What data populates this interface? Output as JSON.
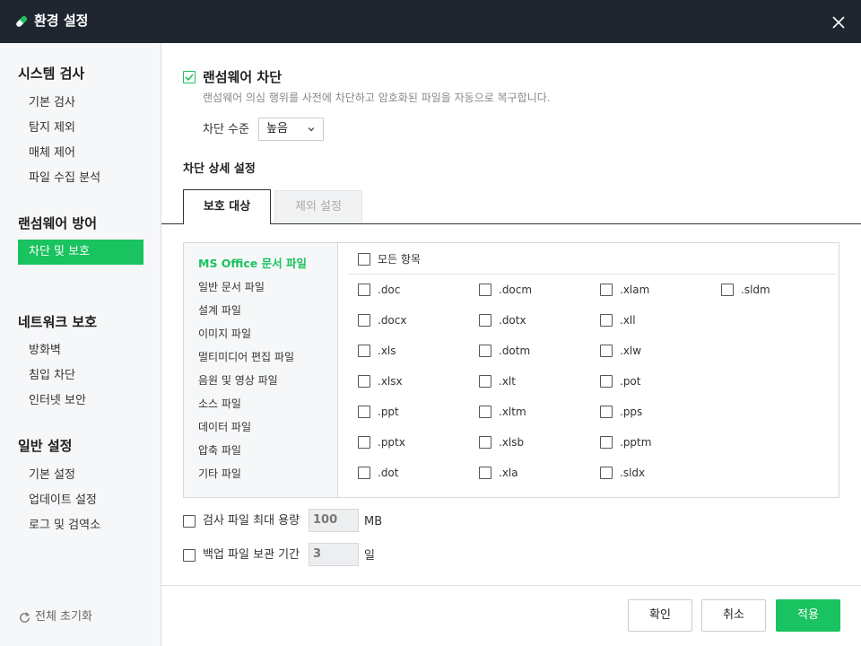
{
  "window": {
    "title": "환경 설정",
    "close_icon": "close-icon"
  },
  "sidebar": {
    "groups": [
      {
        "title": "시스템 검사",
        "items": [
          "기본 검사",
          "탐지 제외",
          "매체 제어",
          "파일 수집 분석"
        ]
      },
      {
        "title": "랜섬웨어 방어",
        "items": [
          "차단 및 보호"
        ]
      },
      {
        "title": "네트워크 보호",
        "items": [
          "방화벽",
          "침입 차단",
          "인터넷 보안"
        ]
      },
      {
        "title": "일반 설정",
        "items": [
          "기본 설정",
          "업데이트 설정",
          "로그 및 검역소"
        ]
      }
    ],
    "active_item": "차단 및 보호",
    "reset_label": "전체 초기화"
  },
  "ransomware": {
    "checked": true,
    "label": "랜섬웨어 차단",
    "description": "랜섬웨어 의심 행위를 사전에 차단하고 암호화된 파일을 자동으로 복구합니다.",
    "level_label": "차단 수준",
    "level_value": "높음"
  },
  "detail": {
    "title": "차단 상세 설정",
    "tabs": [
      {
        "label": "보호 대상",
        "active": true
      },
      {
        "label": "제외 설정",
        "active": false
      }
    ],
    "categories": [
      "MS Office 문서 파일",
      "일반 문서 파일",
      "설계 파일",
      "이미지 파일",
      "멀티미디어 편집 파일",
      "음원 및 영상 파일",
      "소스 파일",
      "데이터 파일",
      "압축 파일",
      "기타 파일"
    ],
    "active_category": "MS Office 문서 파일",
    "all_items_label": "모든 항목",
    "extensions": [
      [
        ".doc",
        ".docm",
        ".xlam",
        ".sldm"
      ],
      [
        ".docx",
        ".dotx",
        ".xll"
      ],
      [
        ".xls",
        ".dotm",
        ".xlw"
      ],
      [
        ".xlsx",
        ".xlt",
        ".pot"
      ],
      [
        ".ppt",
        ".xltm",
        ".pps"
      ],
      [
        ".pptx",
        ".xlsb",
        ".pptm"
      ],
      [
        ".dot",
        ".xla",
        ".sldx"
      ]
    ]
  },
  "options": {
    "max_size_label": "검사 파일 최대 용량",
    "max_size_value": "100",
    "max_size_unit": "MB",
    "backup_label": "백업 파일 보관 기간",
    "backup_value": "3",
    "backup_unit": "일"
  },
  "footer": {
    "ok_label": "확인",
    "cancel_label": "취소",
    "apply_label": "적용"
  },
  "colors": {
    "accent": "#19c35f",
    "titlebar": "#20262f"
  }
}
